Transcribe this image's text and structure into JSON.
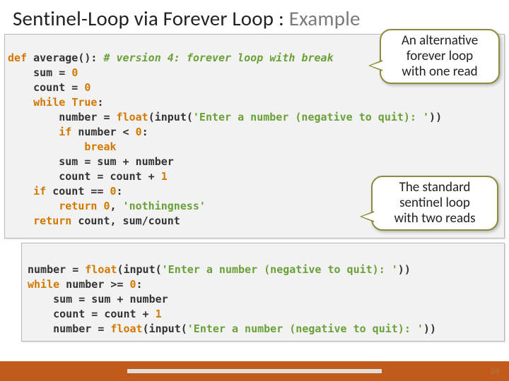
{
  "title_plain": "Sentinel-Loop via Forever Loop : ",
  "title_gray": "Example",
  "callout1_l1": "An alternative",
  "callout1_l2": "forever loop",
  "callout1_l3": "with one read",
  "callout2_l1": "The standard",
  "callout2_l2": "sentinel loop",
  "callout2_l3": "with two reads",
  "c1": {
    "def": "def",
    "fname": " average(): ",
    "comment": "# version 4: forever loop with break",
    "l2a": "    sum = ",
    "l2b": "0",
    "l3a": "    count = ",
    "l3b": "0",
    "l4a": "    ",
    "l4b": "while",
    "l4c": " ",
    "l4d": "True",
    "l4e": ":",
    "l5a": "        number = ",
    "l5b": "float",
    "l5c": "(input(",
    "l5d": "'Enter a number (negative to quit): '",
    "l5e": "))",
    "l6a": "        ",
    "l6b": "if",
    "l6c": " number < ",
    "l6d": "0",
    "l6e": ":",
    "l7a": "            ",
    "l7b": "break",
    "l8": "        sum = sum + number",
    "l9a": "        count = count + ",
    "l9b": "1",
    "l10a": "    ",
    "l10b": "if",
    "l10c": " count == ",
    "l10d": "0",
    "l10e": ":",
    "l11a": "        ",
    "l11b": "return",
    "l11c": " ",
    "l11d": "0",
    "l11e": ", ",
    "l11f": "'nothingness'",
    "l12a": "    ",
    "l12b": "return",
    "l12c": " count, sum/count"
  },
  "c2": {
    "l1a": "number = ",
    "l1b": "float",
    "l1c": "(input(",
    "l1d": "'Enter a number (negative to quit): '",
    "l1e": "))",
    "l2a": "while",
    "l2b": " number >= ",
    "l2c": "0",
    "l2d": ":",
    "l3": "    sum = sum + number",
    "l4a": "    count = count + ",
    "l4b": "1",
    "l5a": "    number = ",
    "l5b": "float",
    "l5c": "(input(",
    "l5d": "'Enter a number (negative to quit): '",
    "l5e": "))"
  },
  "page_number": "24",
  "chart_data": null
}
